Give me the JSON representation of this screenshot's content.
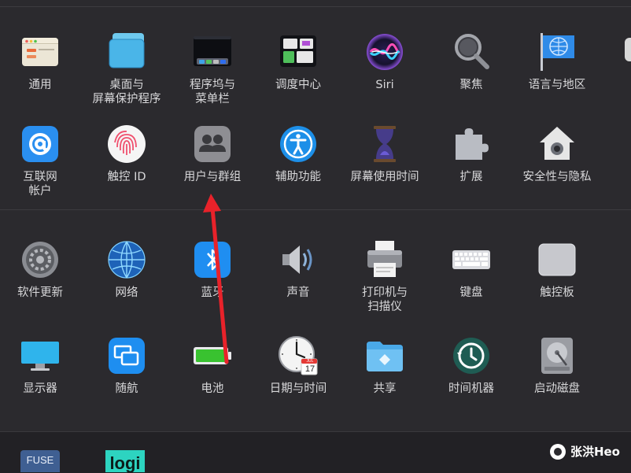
{
  "colors": {
    "background": "#2b2a2e",
    "label": "#d8d8da",
    "arrow": "#e8222a"
  },
  "rows": [
    {
      "items": [
        {
          "label": "通用",
          "icon": "general-icon"
        },
        {
          "label": "桌面与\n屏幕保护程序",
          "icon": "desktop-screensaver-icon"
        },
        {
          "label": "程序坞与\n菜单栏",
          "icon": "dock-menubar-icon"
        },
        {
          "label": "调度中心",
          "icon": "mission-control-icon"
        },
        {
          "label": "Siri",
          "icon": "siri-icon"
        },
        {
          "label": "聚焦",
          "icon": "spotlight-icon"
        },
        {
          "label": "语言与地区",
          "icon": "language-region-icon"
        }
      ]
    },
    {
      "items": [
        {
          "label": "互联网\n帐户",
          "icon": "internet-accounts-icon"
        },
        {
          "label": "触控 ID",
          "icon": "touch-id-icon"
        },
        {
          "label": "用户与群组",
          "icon": "users-groups-icon"
        },
        {
          "label": "辅助功能",
          "icon": "accessibility-icon"
        },
        {
          "label": "屏幕使用时间",
          "icon": "screen-time-icon"
        },
        {
          "label": "扩展",
          "icon": "extensions-icon"
        },
        {
          "label": "安全性与隐私",
          "icon": "security-privacy-icon"
        }
      ]
    },
    {
      "items": [
        {
          "label": "软件更新",
          "icon": "software-update-icon"
        },
        {
          "label": "网络",
          "icon": "network-icon"
        },
        {
          "label": "蓝牙",
          "icon": "bluetooth-icon"
        },
        {
          "label": "声音",
          "icon": "sound-icon"
        },
        {
          "label": "打印机与\n扫描仪",
          "icon": "printers-scanners-icon"
        },
        {
          "label": "键盘",
          "icon": "keyboard-icon"
        },
        {
          "label": "触控板",
          "icon": "trackpad-icon"
        }
      ]
    },
    {
      "items": [
        {
          "label": "显示器",
          "icon": "displays-icon"
        },
        {
          "label": "随航",
          "icon": "sidecar-icon"
        },
        {
          "label": "电池",
          "icon": "battery-icon"
        },
        {
          "label": "日期与时间",
          "icon": "date-time-icon"
        },
        {
          "label": "共享",
          "icon": "sharing-icon"
        },
        {
          "label": "时间机器",
          "icon": "time-machine-icon"
        },
        {
          "label": "启动磁盘",
          "icon": "startup-disk-icon"
        }
      ]
    }
  ],
  "calendar": {
    "month": "JUL",
    "day": "17"
  },
  "dock": {
    "fuse_label": "FUSE",
    "logi_label": "logi"
  },
  "watermark": {
    "text": "张洪Heo"
  }
}
